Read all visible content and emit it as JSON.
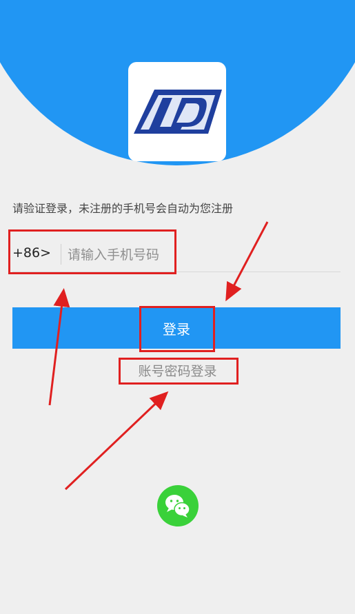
{
  "brand": {
    "logo_letters": "LD",
    "colors": {
      "primary": "#2196f3",
      "background": "#efefef",
      "logo_navy": "#1f3f9e",
      "wechat_green": "#3ad13a",
      "annotation_red": "#e02020"
    }
  },
  "login": {
    "hint": "请验证登录，未注册的手机号会自动为您注册",
    "country_code": "+86>",
    "phone_placeholder": "请输入手机号码",
    "phone_value": "",
    "submit_label": "登录",
    "account_password_link": "账号密码登录"
  },
  "third_party": {
    "wechat_icon": "wechat-icon"
  }
}
